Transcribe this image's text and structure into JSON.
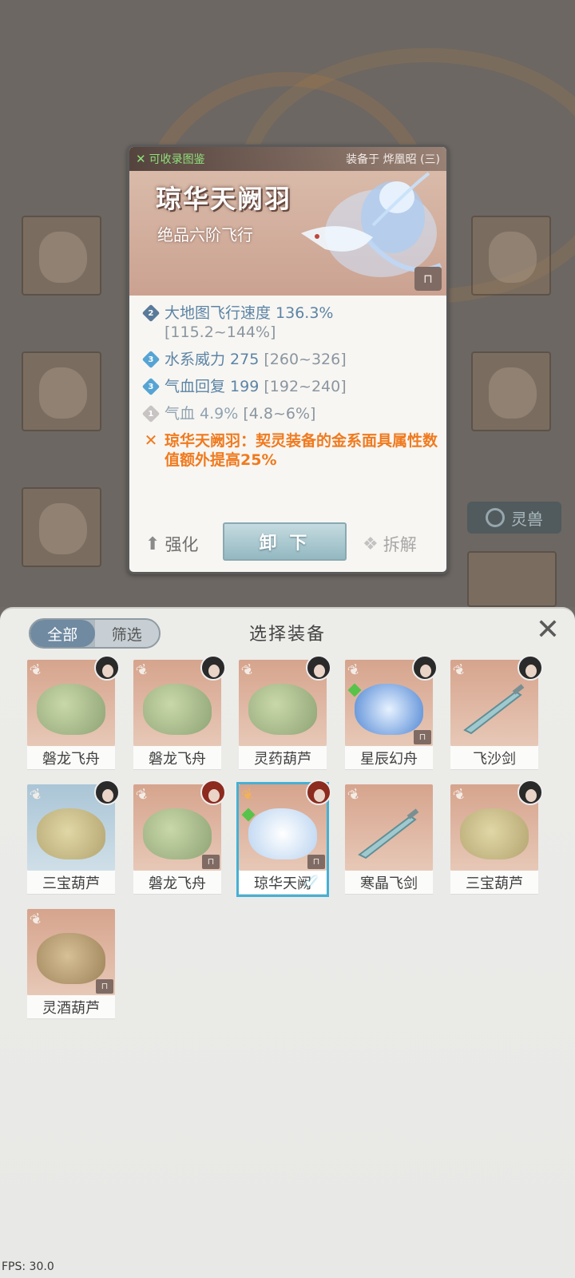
{
  "popup": {
    "collect_label": "可收录图鉴",
    "equipped_on": "装备于 烨凰昭 (三)",
    "item_name": "琼华天阙羽",
    "item_grade": "绝品六阶飞行",
    "attributes": [
      {
        "tier": "2",
        "text": "大地图飞行速度 136.3%",
        "range": "[115.2~144%]"
      },
      {
        "tier": "3",
        "text": "水系威力 275",
        "range": "[260~326]"
      },
      {
        "tier": "3",
        "text": "气血回复 199",
        "range": "[192~240]"
      },
      {
        "tier": "1",
        "text": "气血 4.9%",
        "range": "[4.8~6%]"
      },
      {
        "tier": "special",
        "text": "琼华天阙羽：契灵装备的金系面具属性数值额外提高25%",
        "range": ""
      }
    ],
    "enhance_label": "强化",
    "unequip_label": "卸 下",
    "dismantle_label": "拆解"
  },
  "background": {
    "spirit_beast_label": "灵兽"
  },
  "panel": {
    "tabs": [
      {
        "label": "全部",
        "active": true
      },
      {
        "label": "筛选",
        "active": false
      }
    ],
    "title": "选择装备",
    "close_icon": "close-icon"
  },
  "items": [
    {
      "name": "磐龙飞舟",
      "art": "green",
      "avatar": "dark",
      "wing": "white"
    },
    {
      "name": "磐龙飞舟",
      "art": "green",
      "avatar": "dark",
      "wing": "white"
    },
    {
      "name": "灵药葫芦",
      "art": "green",
      "avatar": "dark",
      "wing": "white"
    },
    {
      "name": "星辰幻舟",
      "art": "blue",
      "avatar": "dark",
      "wing": "white",
      "gem": true,
      "chest": true
    },
    {
      "name": "飞沙剑",
      "art": "sword",
      "avatar": "dark",
      "wing": "white"
    },
    {
      "name": "三宝葫芦",
      "art": "gourd",
      "avatar": "dark",
      "wing": "white",
      "blue": true
    },
    {
      "name": "磐龙飞舟",
      "art": "green",
      "avatar": "red",
      "wing": "white",
      "chest": true
    },
    {
      "name": "琼华天阙",
      "art": "feather",
      "avatar": "red",
      "wing": "gold",
      "gem": true,
      "chest": true,
      "selected": true
    },
    {
      "name": "寒晶飞剑",
      "art": "sword",
      "wing": "white"
    },
    {
      "name": "三宝葫芦",
      "art": "gourd",
      "avatar": "dark",
      "wing": "white"
    },
    {
      "name": "灵酒葫芦",
      "art": "brown",
      "wing": "white",
      "chest": true
    }
  ],
  "fps": "FPS: 30.0"
}
